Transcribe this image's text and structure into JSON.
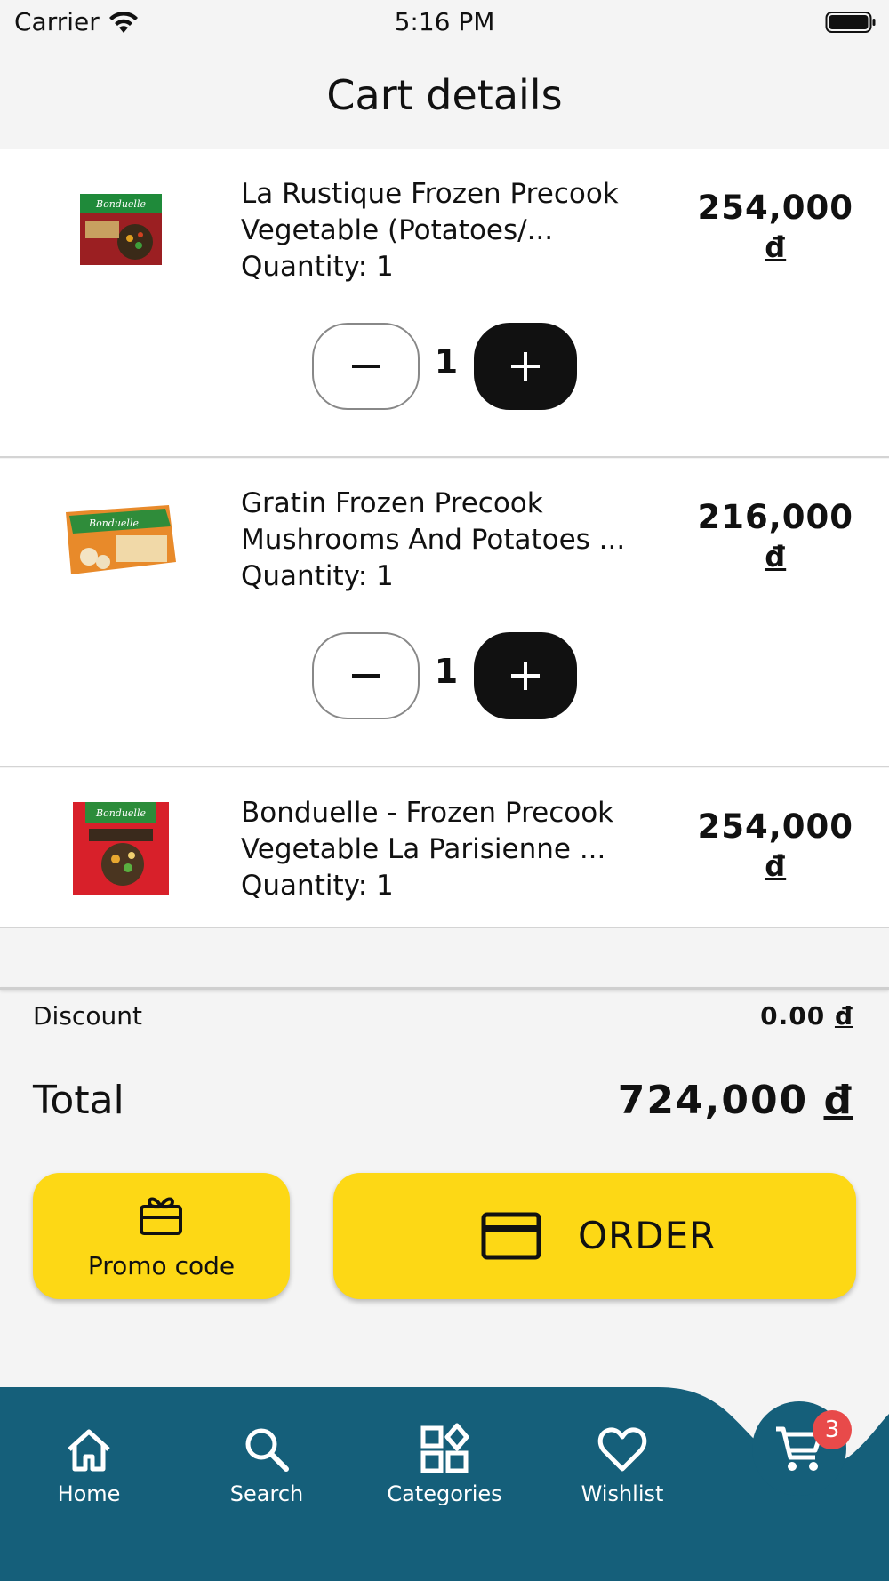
{
  "status_bar": {
    "carrier": "Carrier",
    "time": "5:16 PM"
  },
  "header": {
    "title": "Cart details"
  },
  "cart": {
    "items": [
      {
        "name": "La Rustique Frozen Precook Vegetable (Potatoes/...",
        "quantity_label": "Quantity: 1",
        "price": "254,000",
        "currency": "đ",
        "stepper_value": "1",
        "thumbnail_brand": "Bonduelle"
      },
      {
        "name": "Gratin Frozen Precook Mushrooms And Potatoes ...",
        "quantity_label": "Quantity: 1",
        "price": "216,000",
        "currency": "đ",
        "stepper_value": "1",
        "thumbnail_brand": "Bonduelle"
      },
      {
        "name": "Bonduelle - Frozen Precook Vegetable La Parisienne ...",
        "quantity_label": "Quantity: 1",
        "price": "254,000",
        "currency": "đ",
        "thumbnail_brand": "Bonduelle"
      }
    ]
  },
  "summary": {
    "discount_label": "Discount",
    "discount_value": "0.00",
    "total_label": "Total",
    "total_value": "724,000",
    "currency": "đ"
  },
  "actions": {
    "promo_label": "Promo code",
    "order_label": "ORDER"
  },
  "nav": {
    "home": "Home",
    "search": "Search",
    "categories": "Categories",
    "wishlist": "Wishlist",
    "cart_badge": "3"
  },
  "colors": {
    "accent_yellow": "#fdd815",
    "nav_background": "#155f7a",
    "badge_red": "#e84a4a",
    "page_background": "#f4f4f4"
  }
}
